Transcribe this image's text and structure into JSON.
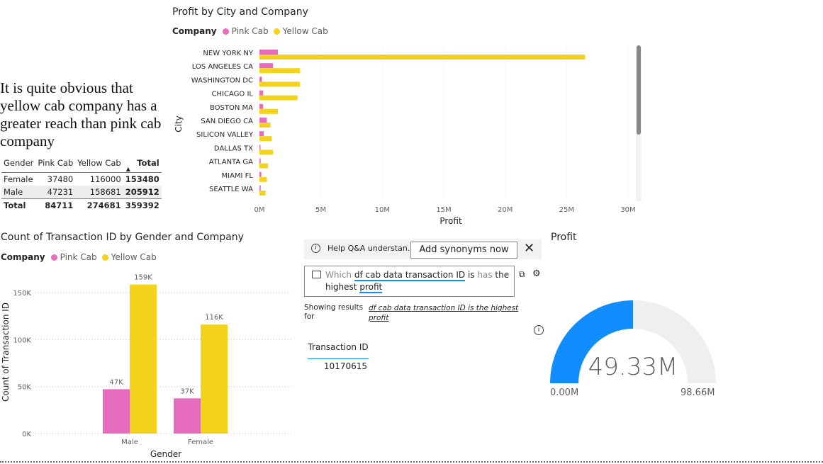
{
  "narrative": "It is quite obvious that yellow cab company has a greater reach than pink cab company",
  "colors": {
    "pink": "#e66cbe",
    "yellow": "#f4d31c",
    "gauge_fill": "#118dff",
    "gauge_bg": "#f0efef"
  },
  "profit_chart": {
    "title": "Profit by City and Company",
    "legend_label": "Company",
    "ylabel": "City",
    "xlabel": "Profit",
    "chart_data": {
      "type": "bar",
      "orientation": "horizontal",
      "title": "Profit by City and Company",
      "xlabel": "Profit",
      "ylabel": "City",
      "categories": [
        "NEW YORK NY",
        "LOS ANGELES CA",
        "WASHINGTON DC",
        "CHICAGO IL",
        "BOSTON MA",
        "SAN DIEGO CA",
        "SILICON VALLEY",
        "DALLAS TX",
        "ATLANTA GA",
        "MIAMI FL",
        "SEATTLE WA"
      ],
      "series": [
        {
          "name": "Pink Cab",
          "values": [
            1.5,
            1.1,
            0.2,
            0.3,
            0.3,
            0.6,
            0.35,
            0.05,
            0.1,
            0.15,
            0.1
          ]
        },
        {
          "name": "Yellow Cab",
          "values": [
            26.5,
            3.3,
            3.3,
            3.1,
            1.5,
            0.9,
            1.0,
            1.1,
            0.7,
            0.6,
            0.5
          ]
        }
      ],
      "xlim": [
        0,
        30
      ],
      "ticks": [
        "0M",
        "5M",
        "10M",
        "15M",
        "20M",
        "25M",
        "30M"
      ],
      "grid": true
    }
  },
  "matrix": {
    "headers": [
      "Gender",
      "Pink Cab",
      "Yellow Cab",
      "Total"
    ],
    "rows": [
      [
        "Female",
        "37480",
        "116000",
        "153480"
      ],
      [
        "Male",
        "47231",
        "158681",
        "205912"
      ]
    ],
    "total": [
      "Total",
      "84711",
      "274681",
      "359392"
    ]
  },
  "count_chart": {
    "title": "Count of Transaction ID by Gender and Company",
    "legend_label": "Company",
    "xlabel": "Gender",
    "ylabel": "Count of Transaction ID",
    "chart_data": {
      "type": "bar",
      "title": "Count of Transaction ID by Gender and Company",
      "xlabel": "Gender",
      "ylabel": "Count of Transaction ID",
      "categories": [
        "Male",
        "Female"
      ],
      "series": [
        {
          "name": "Pink Cab",
          "values": [
            47231,
            37480
          ],
          "labels": [
            "47K",
            "37K"
          ]
        },
        {
          "name": "Yellow Cab",
          "values": [
            158681,
            116000
          ],
          "labels": [
            "159K",
            "116K"
          ]
        }
      ],
      "ylim": [
        0,
        175000
      ],
      "ticks": [
        "0K",
        "50K",
        "100K",
        "150K"
      ],
      "grid": true
    }
  },
  "qa": {
    "info_text": "Help Q&A understan...",
    "synonyms_button": "Add synonyms now",
    "query_parts": [
      "Which",
      "df cab data transaction ID",
      "is",
      "has",
      "the",
      "highest",
      "profit"
    ],
    "showing_label_1": "Showing results",
    "showing_label_2": "for",
    "showing_link_1": "df cab data transaction ID is the highest",
    "showing_link_2": "profit",
    "result_header": "Transaction ID",
    "result_value": "10170615"
  },
  "gauge": {
    "title": "Profit",
    "value_label": "49.33M",
    "min_label": "0.00M",
    "max_label": "98.66M",
    "value": 49.33,
    "min": 0,
    "max": 98.66
  }
}
